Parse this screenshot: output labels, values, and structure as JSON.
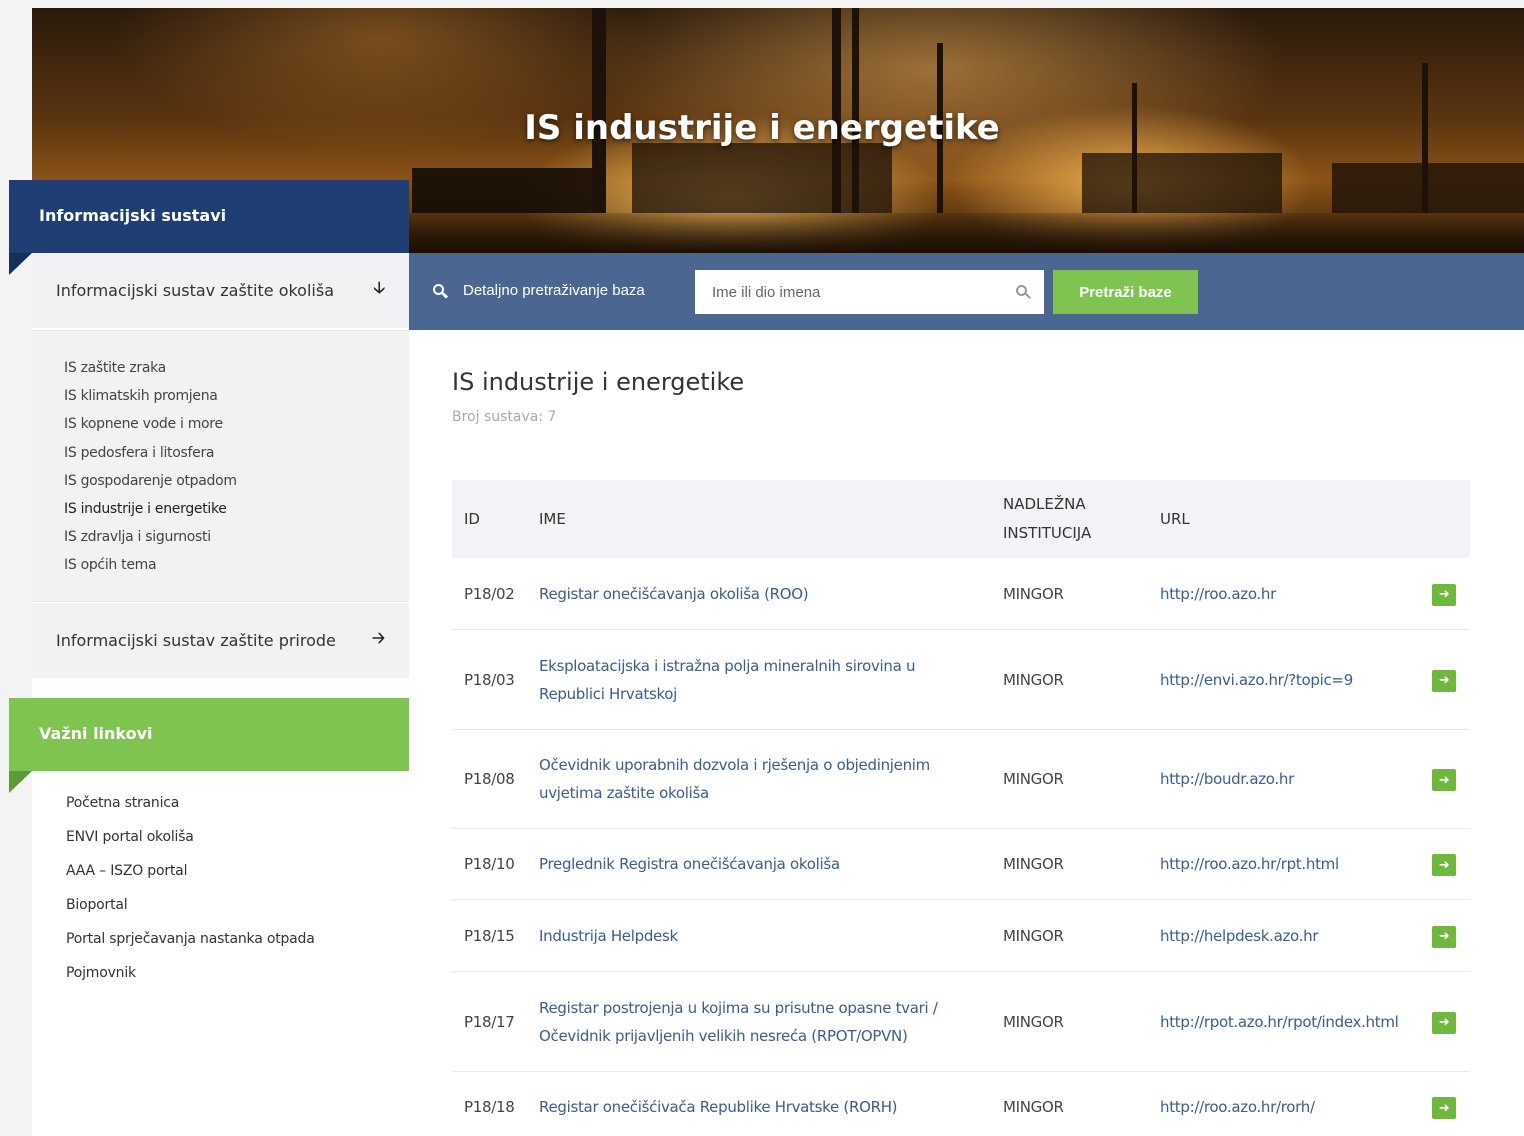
{
  "hero": {
    "title": "IS industrije i energetike"
  },
  "sidebar": {
    "panel_title": "Informacijski sustavi",
    "section_1": {
      "label": "Informacijski sustav zaštite okoliša",
      "icon": "arrow-down-icon"
    },
    "sub_items": [
      {
        "label": "IS zaštite zraka"
      },
      {
        "label": "IS klimatskih promjena"
      },
      {
        "label": "IS kopnene vode i more"
      },
      {
        "label": "IS pedosfera i litosfera"
      },
      {
        "label": "IS gospodarenje otpadom"
      },
      {
        "label": "IS industrije i energetike",
        "active": true
      },
      {
        "label": "IS zdravlja i sigurnosti"
      },
      {
        "label": "IS općih tema"
      }
    ],
    "section_2": {
      "label": "Informacijski sustav zaštite prirode",
      "icon": "arrow-right-icon"
    },
    "links_title": "Važni linkovi",
    "links": [
      {
        "label": "Početna stranica"
      },
      {
        "label": "ENVI portal okoliša"
      },
      {
        "label": "AAA – ISZO portal"
      },
      {
        "label": "Bioportal"
      },
      {
        "label": "Portal sprječavanja nastanka otpada"
      },
      {
        "label": "Pojmovnik"
      }
    ]
  },
  "search": {
    "label": "Detaljno pretraživanje baza",
    "placeholder": "Ime ili dio imena",
    "value": "",
    "button": "Pretraži baze"
  },
  "main": {
    "title": "IS industrije i energetike",
    "count": "Broj sustava: 7",
    "columns": {
      "id": "ID",
      "name": "IME",
      "inst_1": "NADLEŽNA",
      "inst_2": "INSTITUCIJA",
      "url": "URL"
    },
    "rows": [
      {
        "id": "P18/02",
        "name": "Registar onečišćavanja okoliša (ROO)",
        "inst": "MINGOR",
        "url": "http://roo.azo.hr"
      },
      {
        "id": "P18/03",
        "name": "Eksploatacijska i istražna polja mineralnih sirovina u Republici Hrvatskoj",
        "inst": "MINGOR",
        "url": "http://envi.azo.hr/?topic=9"
      },
      {
        "id": "P18/08",
        "name": "Očevidnik uporabnih dozvola i rješenja o objedinjenim uvjetima zaštite okoliša",
        "inst": "MINGOR",
        "url": "http://boudr.azo.hr"
      },
      {
        "id": "P18/10",
        "name": "Preglednik Registra onečišćavanja okoliša",
        "inst": "MINGOR",
        "url": "http://roo.azo.hr/rpt.html"
      },
      {
        "id": "P18/15",
        "name": "Industrija Helpdesk",
        "inst": "MINGOR",
        "url": "http://helpdesk.azo.hr"
      },
      {
        "id": "P18/17",
        "name": "Registar postrojenja u kojima su prisutne opasne tvari / Očevidnik prijavljenih velikih nesreća (RPOT/OPVN)",
        "inst": "MINGOR",
        "url": "http://rpot.azo.hr/rpot/index.html"
      },
      {
        "id": "P18/18",
        "name": "Registar onečišćivača Republike Hrvatske (RORH)",
        "inst": "MINGOR",
        "url": "http://roo.azo.hr/rorh/"
      }
    ],
    "go_icon": "arrow-right-icon"
  },
  "colors": {
    "navy": "#1f3e74",
    "green": "#7fc350",
    "search_bar": "#4b6690",
    "link": "#3b5c94"
  }
}
